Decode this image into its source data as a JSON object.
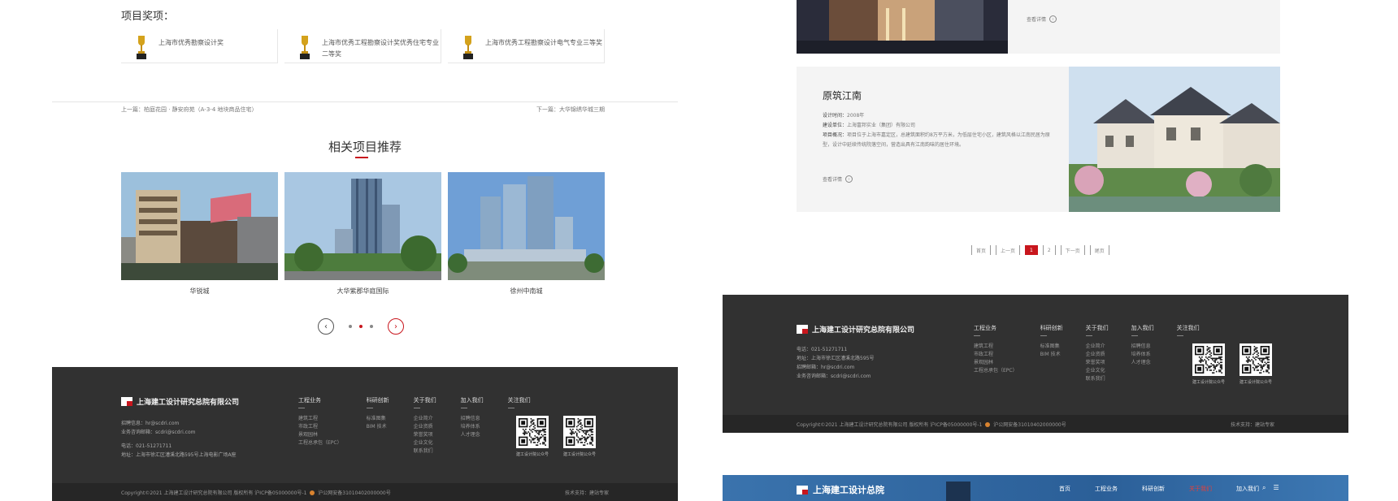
{
  "left": {
    "awards_title": "项目奖项：",
    "awards": [
      {
        "text": "上海市优秀勘察设计奖"
      },
      {
        "text": "上海市优秀工程勘察设计奖优秀住宅专业二等奖"
      },
      {
        "text": "上海市优秀工程勘察设计电气专业三等奖"
      }
    ],
    "prev_link": "上一篇：柏庭花园 · 静安府苑（A-3-4 地块商品住宅）",
    "next_link": "下一篇：大华锦绣华城三期",
    "section_title": "相关项目推荐",
    "projects": [
      {
        "caption": "华锐城"
      },
      {
        "caption": "大华紫郡华庭国际"
      },
      {
        "caption": "徐州中南城"
      }
    ],
    "slider": {
      "prev_glyph": "‹",
      "next_glyph": "›"
    },
    "footer": {
      "company": "上海建工设计研究总院有限公司",
      "contact": [
        "招聘信息：hr@scdri.com",
        "业务咨询邮箱：scdri@scdri.com",
        "电话：021-51271711",
        "地址：上海市徐汇区漕溪北路595号上海电影广场A座"
      ],
      "columns": [
        {
          "title": "工程业务",
          "items": [
            "建筑工程",
            "市政工程",
            "景观园林",
            "工程总承包（EPC）"
          ]
        },
        {
          "title": "科研创新",
          "items": [
            "标准图集",
            "BIM 技术"
          ]
        },
        {
          "title": "关于我们",
          "items": [
            "企业简介",
            "企业资质",
            "荣誉奖项",
            "企业文化",
            "联系我们"
          ]
        },
        {
          "title": "加入我们",
          "items": [
            "招聘信息",
            "培养体系",
            "人才理念"
          ]
        },
        {
          "title": "关注我们",
          "items": []
        }
      ],
      "qr": [
        {
          "label": "建工设计院公众号"
        },
        {
          "label": "建工设计院公众号"
        }
      ],
      "copyright": "Copyright©2021 上海建工设计研究总院有限公司 版权所有 沪ICP备05000000号-1",
      "police": "沪公网安备31010402000000号",
      "credit": "技术支持：建站专家"
    }
  },
  "right": {
    "card_top": {
      "more": "查看详情"
    },
    "card2": {
      "name": "原筑江南",
      "meta": [
        {
          "k": "设计时间：",
          "v": "2008年"
        },
        {
          "k": "建设单位：",
          "v": "上海富邦实业（集团）有限公司"
        },
        {
          "k": "项目概况：",
          "v": "项目位于上海市嘉定区，总建筑面积约8万平方米，为低层住宅小区，建筑风格以江南民居为原型，设计中延续传统院落空间，营造出具有江南韵味的居住环境。"
        }
      ],
      "more": "查看详情"
    },
    "pager": [
      "首页",
      "上一页",
      "1",
      "2",
      "下一页",
      "尾页"
    ],
    "pager_active": "1",
    "footer": {
      "company": "上海建工设计研究总院有限公司",
      "contact": [
        "电话：021-51271711",
        "地址：上海市徐汇区漕溪北路595号",
        "招聘邮箱：hr@scdri.com",
        "业务咨询邮箱：scdri@scdri.com"
      ],
      "columns": [
        {
          "title": "工程业务",
          "items": [
            "建筑工程",
            "市政工程",
            "景观园林",
            "工程总承包（EPC）"
          ]
        },
        {
          "title": "科研创新",
          "items": [
            "标准图集",
            "BIM 技术"
          ]
        },
        {
          "title": "关于我们",
          "items": [
            "企业简介",
            "企业资质",
            "荣誉奖项",
            "企业文化",
            "联系我们"
          ]
        },
        {
          "title": "加入我们",
          "items": [
            "招聘信息",
            "培养体系",
            "人才理念"
          ]
        },
        {
          "title": "关注我们",
          "items": []
        }
      ],
      "qr": [
        {
          "label": "建工设计院公众号"
        },
        {
          "label": "建工设计院公众号"
        }
      ],
      "copyright": "Copyright©2021 上海建工设计研究总院有限公司 版权所有 沪ICP备05000000号-1",
      "police": "沪公网安备31010402000000号",
      "credit": "技术支持：建站专家"
    },
    "nav": {
      "brand": "上海建工设计总院",
      "items": [
        "首页",
        "工程业务",
        "科研创新",
        "关于我们",
        "加入我们"
      ],
      "active": "关于我们",
      "search_glyph": "⌕",
      "menu_glyph": "☰"
    }
  },
  "colors": {
    "accent": "#c8161d",
    "footer_bg": "#313131",
    "nav_bg": "#2f6aa5"
  }
}
